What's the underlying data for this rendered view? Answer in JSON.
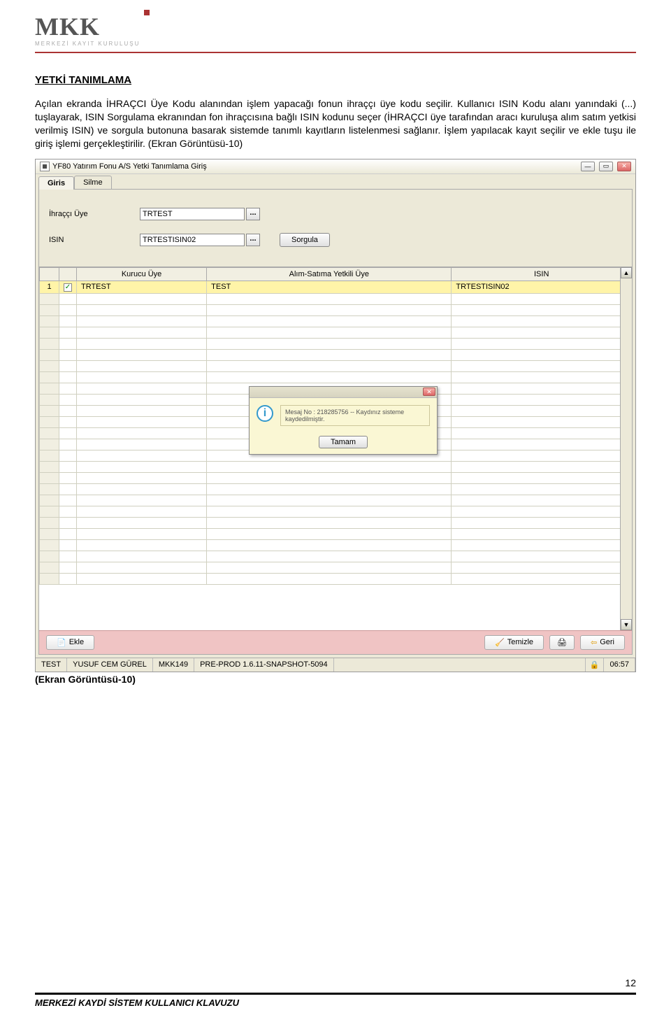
{
  "header": {
    "logo_main": "MKK",
    "logo_sub": "MERKEZİ KAYIT KURULUŞU"
  },
  "content": {
    "title": "YETKİ TANIMLAMA",
    "paragraph": "Açılan ekranda İHRAÇCI Üye Kodu alanından işlem yapacağı fonun ihraççı üye kodu seçilir. Kullanıcı ISIN Kodu alanı yanındaki (...) tuşlayarak, ISIN Sorgulama ekranından fon ihraçcısına bağlı ISIN kodunu seçer (İHRAÇCI üye tarafından aracı kuruluşa alım satım yetkisi verilmiş ISIN) ve sorgula butonuna basarak sistemde tanımlı kayıtların listelenmesi sağlanır. İşlem yapılacak kayıt seçilir ve ekle tuşu ile giriş işlemi gerçekleştirilir. (Ekran Görüntüsü-10)"
  },
  "window": {
    "title": "YF80 Yatırım Fonu A/S Yetki Tanımlama Giriş",
    "tabs": {
      "giris": "Giris",
      "silme": "Silme"
    },
    "form": {
      "ihracc_label": "İhraççı Üye",
      "ihracc_value": "TRTEST",
      "isin_label": "ISIN",
      "isin_value": "TRTESTISIN02",
      "dots": "...",
      "sorgula": "Sorgula"
    },
    "table": {
      "col1": "Kurucu Üye",
      "col2": "Alım-Satıma Yetkili Üye",
      "col3": "ISIN",
      "row": {
        "num": "1",
        "kurucu": "TRTEST",
        "yetkili": "TEST",
        "isin": "TRTESTISIN02",
        "check": "✓"
      }
    },
    "modal": {
      "message": "Mesaj No : 218285756 -- Kaydınız sisteme kaydedilmiştir.",
      "ok": "Tamam"
    },
    "actions": {
      "ekle": "Ekle",
      "temizle": "Temizle",
      "geri": "Geri"
    },
    "status": {
      "s1": "TEST",
      "s2": "YUSUF CEM GÜREL",
      "s3": "MKK149",
      "s4": "PRE-PROD 1.6.11-SNAPSHOT-5094",
      "time": "06:57"
    }
  },
  "caption": "(Ekran Görüntüsü-10)",
  "footer": {
    "page": "12",
    "text": "MERKEZİ KAYDİ SİSTEM KULLANICI KLAVUZU"
  }
}
